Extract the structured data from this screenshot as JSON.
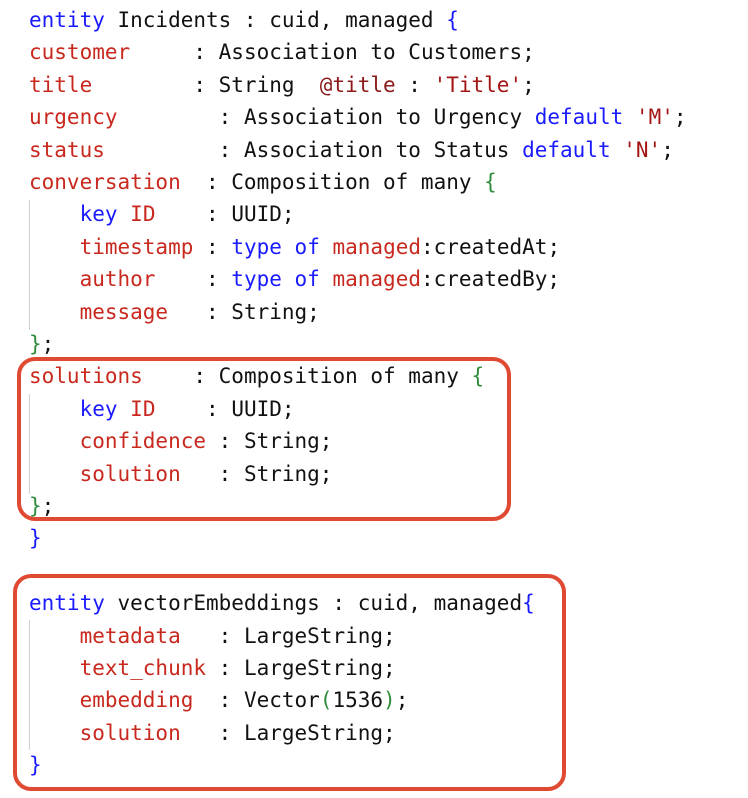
{
  "colors": {
    "keyword": "#1a1aff",
    "field": "#c8281e",
    "string": "#a31515",
    "annotation": "#8b1a1a",
    "brace_green": "#2e8b3a",
    "plain": "#111111",
    "highlight_border": "#e04a33",
    "indent_guide": "#d0d0d0"
  },
  "code_lines": [
    [
      [
        "kw",
        "entity"
      ],
      [
        "plain",
        " Incidents : cuid, managed "
      ],
      [
        "brace-blue",
        "{"
      ]
    ],
    [
      [
        "field",
        "customer"
      ],
      [
        "plain",
        "     : Association to Customers;"
      ]
    ],
    [
      [
        "field",
        "title"
      ],
      [
        "plain",
        "        : String  "
      ],
      [
        "anno",
        "@title"
      ],
      [
        "plain",
        " : "
      ],
      [
        "str",
        "'Title'"
      ],
      [
        "plain",
        ";"
      ]
    ],
    [
      [
        "field",
        "urgency"
      ],
      [
        "plain",
        "        : Association to Urgency "
      ],
      [
        "kw",
        "default"
      ],
      [
        "plain",
        " "
      ],
      [
        "str",
        "'M'"
      ],
      [
        "plain",
        ";"
      ]
    ],
    [
      [
        "field",
        "status"
      ],
      [
        "plain",
        "         : Association to Status "
      ],
      [
        "kw",
        "default"
      ],
      [
        "plain",
        " "
      ],
      [
        "str",
        "'N'"
      ],
      [
        "plain",
        ";"
      ]
    ],
    [
      [
        "field",
        "conversation"
      ],
      [
        "plain",
        "  : Composition of many "
      ],
      [
        "brace-green",
        "{"
      ]
    ],
    [
      [
        "plain",
        "    "
      ],
      [
        "kw",
        "key"
      ],
      [
        "plain",
        " "
      ],
      [
        "field",
        "ID"
      ],
      [
        "plain",
        "    : UUID;"
      ]
    ],
    [
      [
        "plain",
        "    "
      ],
      [
        "field",
        "timestamp"
      ],
      [
        "plain",
        " : "
      ],
      [
        "kw",
        "type"
      ],
      [
        "plain",
        " "
      ],
      [
        "kw",
        "of"
      ],
      [
        "plain",
        " "
      ],
      [
        "field",
        "managed"
      ],
      [
        "plain",
        ":createdAt;"
      ]
    ],
    [
      [
        "plain",
        "    "
      ],
      [
        "field",
        "author"
      ],
      [
        "plain",
        "    : "
      ],
      [
        "kw",
        "type"
      ],
      [
        "plain",
        " "
      ],
      [
        "kw",
        "of"
      ],
      [
        "plain",
        " "
      ],
      [
        "field",
        "managed"
      ],
      [
        "plain",
        ":createdBy;"
      ]
    ],
    [
      [
        "plain",
        "    "
      ],
      [
        "field",
        "message"
      ],
      [
        "plain",
        "   : String;"
      ]
    ],
    [
      [
        "brace-green",
        "}"
      ],
      [
        "plain",
        ";"
      ]
    ],
    [
      [
        "field",
        "solutions"
      ],
      [
        "plain",
        "    : Composition of many "
      ],
      [
        "brace-green",
        "{"
      ]
    ],
    [
      [
        "plain",
        "    "
      ],
      [
        "kw",
        "key"
      ],
      [
        "plain",
        " "
      ],
      [
        "field",
        "ID"
      ],
      [
        "plain",
        "    : UUID;"
      ]
    ],
    [
      [
        "plain",
        "    "
      ],
      [
        "field",
        "confidence"
      ],
      [
        "plain",
        " : String;"
      ]
    ],
    [
      [
        "plain",
        "    "
      ],
      [
        "field",
        "solution"
      ],
      [
        "plain",
        "   : String;"
      ]
    ],
    [
      [
        "brace-green",
        "}"
      ],
      [
        "plain",
        ";"
      ]
    ],
    [
      [
        "brace-blue",
        "}"
      ]
    ],
    [
      [
        "plain",
        ""
      ]
    ],
    [
      [
        "kw",
        "entity"
      ],
      [
        "plain",
        " vectorEmbeddings : cuid, managed"
      ],
      [
        "brace-blue",
        "{"
      ]
    ],
    [
      [
        "plain",
        "    "
      ],
      [
        "field",
        "metadata"
      ],
      [
        "plain",
        "   : LargeString;"
      ]
    ],
    [
      [
        "plain",
        "    "
      ],
      [
        "field",
        "text_chunk"
      ],
      [
        "plain",
        " : LargeString;"
      ]
    ],
    [
      [
        "plain",
        "    "
      ],
      [
        "field",
        "embedding"
      ],
      [
        "plain",
        "  : Vector"
      ],
      [
        "brace-green",
        "("
      ],
      [
        "plain",
        "1536"
      ],
      [
        "brace-green",
        ")"
      ],
      [
        "plain",
        ";"
      ]
    ],
    [
      [
        "plain",
        "    "
      ],
      [
        "field",
        "solution"
      ],
      [
        "plain",
        "   : LargeString;"
      ]
    ],
    [
      [
        "brace-blue",
        "}"
      ]
    ]
  ]
}
